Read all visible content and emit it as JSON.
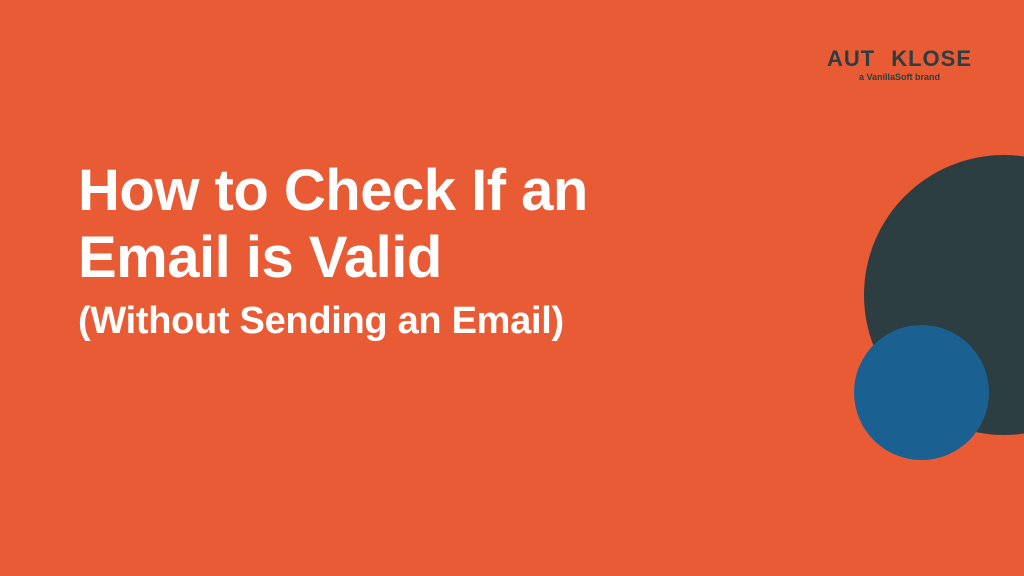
{
  "logo": {
    "name_pre": "AUT",
    "name_post": "KLOSE",
    "tagline": "a VanillaSoft brand"
  },
  "content": {
    "title_line1": "How to Check If an",
    "title_line2": "Email is Valid",
    "subtitle": "(Without Sending an Email)"
  },
  "colors": {
    "background": "#E85B34",
    "dark_circle": "#2C3E42",
    "blue_circle": "#1A6191",
    "text": "#FFFFFF"
  }
}
